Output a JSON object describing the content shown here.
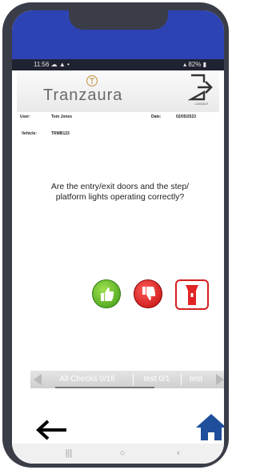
{
  "status_bar": {
    "time": "11:56",
    "left_icons": "☁ ▲ •",
    "right_text": "82%"
  },
  "brand": {
    "name": "Tranzaura",
    "logout_label": "LOGOUT"
  },
  "info": {
    "user_label": "User:",
    "user_value": "Tom Jones",
    "date_label": "Date:",
    "date_value": "02/05/2023",
    "vehicle_label": "Vehicle:",
    "vehicle_value": "TRMB123"
  },
  "question": "Are the entry/exit doors and the step/ platform lights operating correctly?",
  "actions": {
    "yes_icon": "thumbs-up-icon",
    "no_icon": "thumbs-down-icon",
    "torch_icon": "flashlight-icon"
  },
  "tabs": [
    {
      "label": "All Checks 0/16",
      "selected": true
    },
    {
      "label": "test 0/1",
      "selected": false
    },
    {
      "label": "test",
      "selected": false
    }
  ],
  "nav": {
    "recents": "|||",
    "home": "○",
    "back": "‹"
  },
  "colors": {
    "header_blue": "#2d43b4",
    "yes_green": "#4caf1e",
    "no_red": "#d11414",
    "home_blue": "#1f4e9c"
  }
}
